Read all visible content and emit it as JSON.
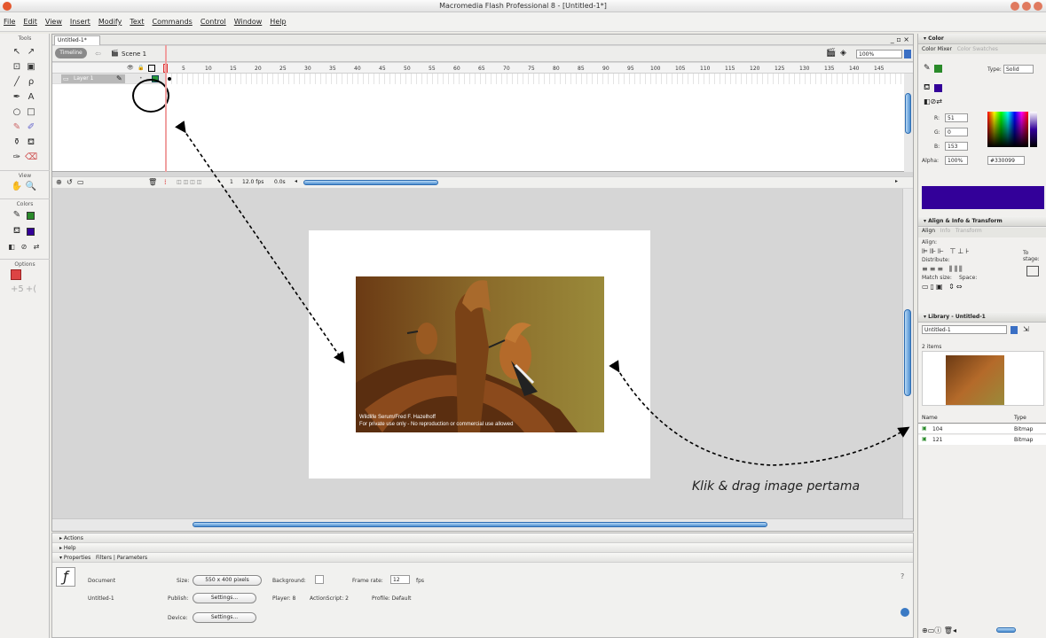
{
  "window": {
    "title": "Macromedia Flash Professional 8 - [Untitled-1*]"
  },
  "menu": [
    "File",
    "Edit",
    "View",
    "Insert",
    "Modify",
    "Text",
    "Commands",
    "Control",
    "Window",
    "Help"
  ],
  "tools": {
    "tools_label": "Tools",
    "view_label": "View",
    "colors_label": "Colors",
    "options_label": "Options"
  },
  "document": {
    "tab": "Untitled-1*",
    "timeline_btn": "Timeline",
    "scene": "Scene 1",
    "zoom": "100%",
    "layer_name": "Layer 1",
    "ruler": [
      "5",
      "10",
      "15",
      "20",
      "25",
      "30",
      "35",
      "40",
      "45",
      "50",
      "55",
      "60",
      "65",
      "70",
      "75",
      "80",
      "85",
      "90",
      "95",
      "100",
      "105",
      "110",
      "115",
      "120",
      "125",
      "130",
      "135",
      "140",
      "145"
    ],
    "frame_number": "1",
    "fps": "12.0 fps",
    "time": "0.0s",
    "photo_caption_1": "Wildlife Serum/Fred F. Hazelhoff",
    "photo_caption_2": "For private use only - No reproduction or commercial use allowed"
  },
  "panels": {
    "actions": "Actions",
    "help": "Help",
    "properties_tab": "Properties",
    "filters_tab": "Filters",
    "parameters_tab": "Parameters",
    "doc_type": "Document",
    "doc_name": "Untitled-1",
    "size_label": "Size:",
    "size_value": "550 x 400 pixels",
    "background_label": "Background:",
    "frame_rate_label": "Frame rate:",
    "frame_rate_value": "12",
    "fps_unit": "fps",
    "publish_label": "Publish:",
    "settings_btn": "Settings...",
    "player": "Player: 8",
    "actionscript": "ActionScript: 2",
    "profile": "Profile: Default",
    "device_label": "Device:"
  },
  "color_panel": {
    "title": "Color",
    "tab_mixer": "Color Mixer",
    "tab_swatches": "Color Swatches",
    "type_label": "Type:",
    "type_value": "Solid",
    "r_label": "R:",
    "r": "51",
    "g_label": "G:",
    "g": "0",
    "b_label": "B:",
    "b": "153",
    "alpha_label": "Alpha:",
    "alpha": "100%",
    "hex": "#330099",
    "swatch_color": "#330099"
  },
  "align_panel": {
    "title": "Align & Info & Transform",
    "tab_align": "Align",
    "tab_info": "Info",
    "tab_transform": "Transform",
    "align_label": "Align:",
    "distribute_label": "Distribute:",
    "match_size_label": "Match size:",
    "space_label": "Space:",
    "to_stage": "To stage:"
  },
  "library_panel": {
    "title": "Library - Untitled-1",
    "doc_select": "Untitled-1",
    "count": "2 items",
    "col_name": "Name",
    "col_type": "Type",
    "items": [
      {
        "name": "104",
        "type": "Bitmap"
      },
      {
        "name": "121",
        "type": "Bitmap"
      }
    ]
  },
  "annotation": {
    "caption": "Klik & drag image pertama"
  }
}
